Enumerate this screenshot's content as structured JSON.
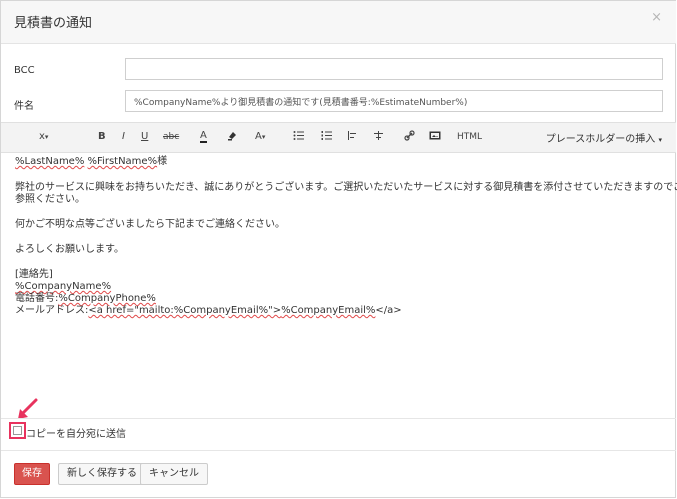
{
  "dialog": {
    "title": "見積書の通知",
    "close_glyph": "×"
  },
  "form": {
    "bcc_label": "BCC",
    "bcc_value": "",
    "subject_label": "件名",
    "subject_value": "%CompanyName%より御見積書の通知です(見積書番号:%EstimateNumber%)"
  },
  "toolbar": {
    "font_size": "x",
    "bold": "B",
    "italic": "I",
    "underline": "U",
    "strike": "abc",
    "font_color": "A",
    "font_family": "A",
    "html": "HTML",
    "placeholder_menu": "プレースホルダーの挿入",
    "icons": [
      "caret-down-icon",
      "highlight-icon",
      "unordered-list-icon",
      "ordered-list-icon",
      "align-icon",
      "indent-icon",
      "link-icon",
      "image-icon"
    ]
  },
  "editor": {
    "greeting_lastname": "%LastName%",
    "greeting_firstname": "%FirstName%",
    "greeting_suffix": "様",
    "body_line1": "弊社のサービスに興味をお持ちいただき、誠にありがとうございます。ご選択いただいたサービスに対する御見積書を添付させていただきますのでご",
    "body_line2": "参照ください。",
    "body_line3": "何かご不明な点等ございましたら下記までご連絡ください。",
    "body_line4": "よろしくお願いします。",
    "contact_header": "[連絡先]",
    "company_name": "%CompanyName%",
    "phone_prefix": "電話番号:",
    "phone_value": "%CompanyPhone%",
    "mail_prefix": "メールアドレス:",
    "mail_tag_open": "<a href=\"mailto:%CompanyEmail%\">",
    "mail_value": "%CompanyEmail%",
    "mail_tag_close": "</a>"
  },
  "copy_to_self": {
    "label": "コピーを自分宛に送信",
    "checked": false
  },
  "footer": {
    "save": "保存",
    "save_new": "新しく保存する",
    "cancel": "キャンセル"
  },
  "colors": {
    "primary": "#d9534f",
    "highlight": "#e8335e"
  }
}
